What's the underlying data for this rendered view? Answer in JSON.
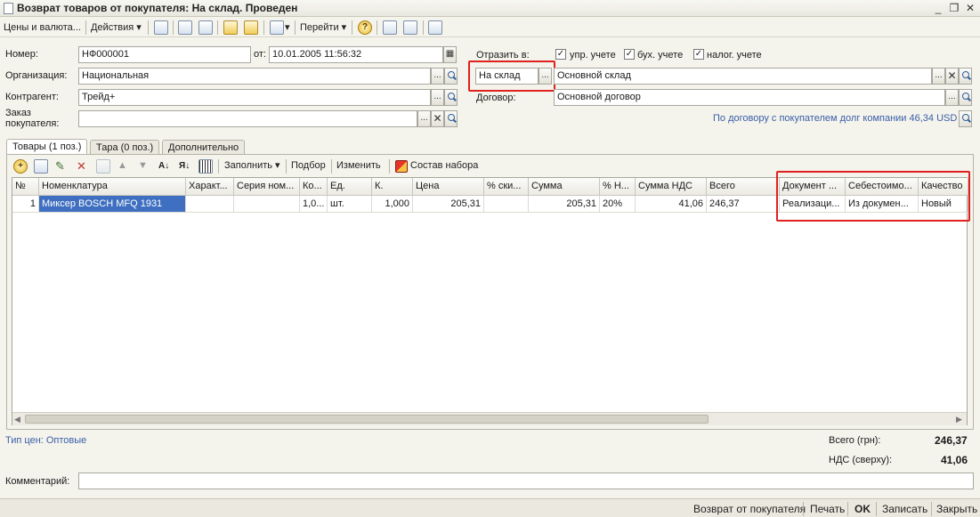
{
  "window": {
    "title": "Возврат товаров от покупателя: На склад. Проведен",
    "minimize_glyph": "_",
    "restore_glyph": "❐",
    "close_glyph": "✕"
  },
  "toolbar": {
    "prices_currency": "Цены и валюта...",
    "actions": "Действия ▾",
    "goto": "Перейти ▾",
    "help": "?"
  },
  "header": {
    "number_label": "Номер:",
    "number_value": "НФ000001",
    "from_label": "от:",
    "date_value": "10.01.2005 11:56:32",
    "org_label": "Организация:",
    "org_value": "Национальная",
    "contractor_label": "Контрагент:",
    "contractor_value": "Трейд+",
    "order_label_line1": "Заказ",
    "order_label_line2": "покупателя:",
    "order_value": "",
    "reflect_label": "Отразить в:",
    "chk_mgmt": "упр. учете",
    "chk_acc": "бух. учете",
    "chk_tax": "налог. учете",
    "check_glyph": "✓",
    "dest_value": "На склад",
    "warehouse_value": "Основной склад",
    "contract_label": "Договор:",
    "contract_value": "Основной договор",
    "debt_info": "По договору с покупателем долг компании 46,34 USD",
    "ellipsis": "...",
    "clear_glyph": "✕"
  },
  "tabs": [
    {
      "label": "Товары (1 поз.)"
    },
    {
      "label": "Тара (0 поз.)"
    },
    {
      "label": "Дополнительно"
    }
  ],
  "table_toolbar": {
    "fill": "Заполнить ▾",
    "pick": "Подбор",
    "edit": "Изменить",
    "kit": "Состав набора"
  },
  "table": {
    "columns": [
      "№",
      "Номенклатура",
      "Характ...",
      "Серия ном...",
      "Ко...",
      "Ед.",
      "К.",
      "Цена",
      "% ски...",
      "Сумма",
      "% Н...",
      "Сумма НДС",
      "Всего",
      "Документ ...",
      "Себестоимо...",
      "Качество"
    ],
    "rows": [
      [
        "1",
        "Миксер BOSCH MFQ 1931",
        "",
        "",
        "1,0...",
        "шт.",
        "1,000",
        "205,31",
        "",
        "205,31",
        "20%",
        "41,06",
        "246,37",
        "Реализаци...",
        "Из докумен...",
        "Новый"
      ]
    ]
  },
  "footer": {
    "price_type": "Тип цен: Оптовые",
    "total_label": "Всего (грн):",
    "total_value": "246,37",
    "vat_label": "НДС (сверху):",
    "vat_value": "41,06",
    "comment_label": "Комментарий:",
    "comment_value": ""
  },
  "statusbar": {
    "return_btn": "Возврат от покупателя",
    "print_btn": "Печать",
    "ok_btn": "OK",
    "save_btn": "Записать",
    "close_btn": "Закрыть"
  }
}
